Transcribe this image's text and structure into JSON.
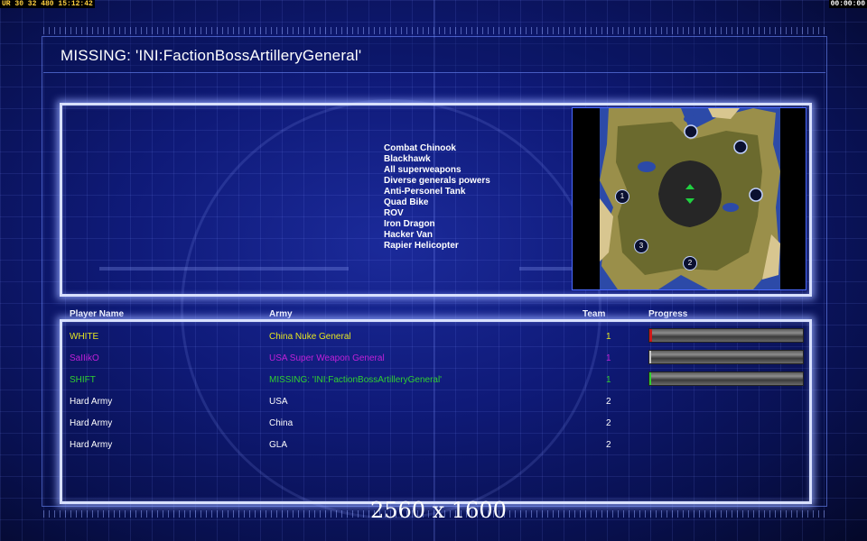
{
  "hud": {
    "left_text": "UR 30 32 480 15:12:42",
    "right_text": "00:00:00"
  },
  "header": {
    "title": "MISSING: 'INI:FactionBossArtilleryGeneral'"
  },
  "units": [
    "Combat Chinook",
    "Blackhawk",
    "All superweapons",
    "Diverse generals powers",
    "Anti-Personel Tank",
    "Quad Bike",
    "ROV",
    "Iron Dragon",
    "Hacker Van",
    "Rapier Helicopter"
  ],
  "columns": {
    "name": "Player Name",
    "army": "Army",
    "team": "Team",
    "progress": "Progress"
  },
  "players": [
    {
      "name": "WHITE",
      "army": "China Nuke General",
      "team": "1",
      "color": "#e6e620",
      "progress": 0.02,
      "fill": "#d01818"
    },
    {
      "name": "SaIIikO",
      "army": "USA Super Weapon General",
      "team": "1",
      "color": "#c020d8",
      "progress": 0.01,
      "fill": "#c8c8c8"
    },
    {
      "name": "SHIFT",
      "army": "MISSING: 'INI:FactionBossArtilleryGeneral'",
      "team": "1",
      "color": "#30d030",
      "progress": 0.0,
      "fill": "#30d030"
    },
    {
      "name": "Hard Army",
      "army": "USA",
      "team": "2",
      "color": "#ffffff"
    },
    {
      "name": "Hard Army",
      "army": "China",
      "team": "2",
      "color": "#ffffff"
    },
    {
      "name": "Hard Army",
      "army": "GLA",
      "team": "2",
      "color": "#ffffff"
    }
  ],
  "map": {
    "markers": [
      "1",
      "2",
      "3"
    ]
  },
  "resolution_text": "2560 x 1600"
}
